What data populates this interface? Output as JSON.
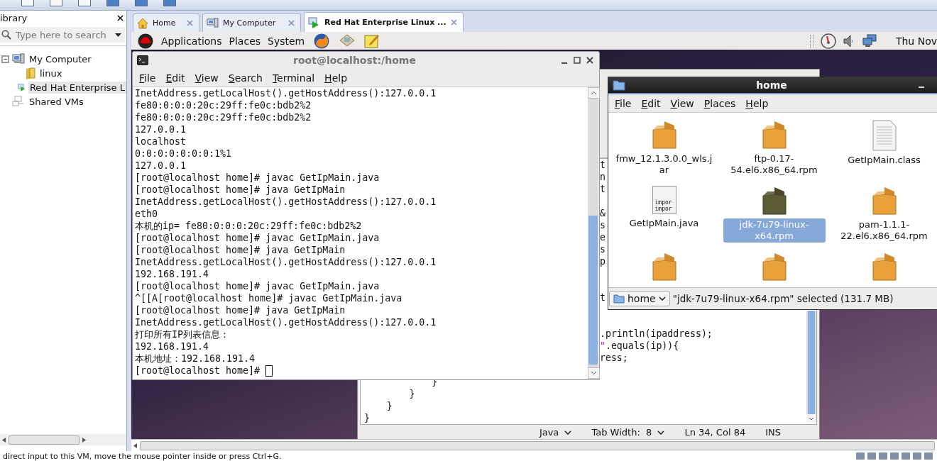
{
  "sidebar": {
    "title": "ibrary",
    "search": {
      "placeholder": "Type here to search"
    },
    "tree": [
      {
        "label": "My Computer",
        "kind": "computer",
        "expanded": true,
        "selected": false,
        "children": [
          {
            "label": "linux",
            "kind": "folder",
            "selected": false
          },
          {
            "label": "Red Hat Enterprise L",
            "kind": "vm",
            "selected": true
          }
        ]
      },
      {
        "label": "Shared VMs",
        "kind": "shared",
        "selected": false
      }
    ]
  },
  "tabs": [
    {
      "label": "Home",
      "kind": "home",
      "selected": false
    },
    {
      "label": "My Computer",
      "kind": "computer",
      "selected": false
    },
    {
      "label": "Red Hat Enterprise Linux ...",
      "kind": "vm",
      "selected": true
    }
  ],
  "guest_panel": {
    "menus": [
      "Applications",
      "Places",
      "System"
    ],
    "clock": "Thu Nov"
  },
  "terminal": {
    "title": "root@localhost:/home",
    "menus": [
      "File",
      "Edit",
      "View",
      "Search",
      "Terminal",
      "Help"
    ],
    "cursor": true,
    "lines": [
      "InetAddress.getLocalHost().getHostAddress():127.0.0.1",
      "fe80:0:0:0:20c:29ff:fe0c:bdb2%2",
      "fe80:0:0:0:20c:29ff:fe0c:bdb2%2",
      "127.0.0.1",
      "localhost",
      "0:0:0:0:0:0:0:1%1",
      "127.0.0.1",
      "[root@localhost home]# javac GetIpMain.java",
      "[root@localhost home]# java GetIpMain",
      "InetAddress.getLocalHost().getHostAddress():127.0.0.1",
      "eth0",
      "本机的ip= fe80:0:0:0:20c:29ff:fe0c:bdb2%2",
      "[root@localhost home]# javac GetIpMain.java",
      "[root@localhost home]# java GetIpMain",
      "InetAddress.getLocalHost().getHostAddress():127.0.0.1",
      "192.168.191.4",
      "[root@localhost home]# javac GetIpMain.java",
      "^[[A[root@localhost home]# javac GetIpMain.java",
      "[root@localhost home]# java GetIpMain",
      "InetAddress.getLocalHost().getHostAddress():127.0.0.1",
      "打印所有IP列表信息：",
      "192.168.191.4",
      "本机地址：192.168.191.4",
      "[root@localhost home]# "
    ]
  },
  "editor": {
    "text_blocks": [
      {
        "lines": [
          [
            {
              "kind": "code",
              "text": "t"
            }
          ],
          [
            {
              "kind": "code",
              "text": "n"
            }
          ],
          [
            {
              "kind": "code",
              "text": "t"
            }
          ]
        ]
      },
      {
        "lines": [
          [
            {
              "kind": "code",
              "text": "&"
            }
          ],
          [
            {
              "kind": "code",
              "text": "s"
            }
          ],
          [
            {
              "kind": "code",
              "text": "e"
            }
          ],
          [
            {
              "kind": "code",
              "text": "s"
            }
          ],
          [
            {
              "kind": "code",
              "text": "p"
            }
          ]
        ]
      },
      {
        "lines": [
          [
            {
              "kind": "code",
              "text": "t"
            }
          ]
        ]
      },
      {
        "lines": [
          [
            {
              "kind": "code",
              "text": ".println(ipaddress);"
            }
          ],
          [
            {
              "kind": "string",
              "text": "\""
            },
            {
              "kind": "code",
              "text": ".equals(ip)){"
            }
          ],
          [
            {
              "kind": "code",
              "text": "ress;"
            }
          ]
        ]
      },
      {
        "lines": [
          [
            {
              "kind": "code",
              "text": "            }"
            }
          ],
          [
            {
              "kind": "code",
              "text": "        }"
            }
          ],
          [
            {
              "kind": "code",
              "text": "    }"
            }
          ],
          [
            {
              "kind": "code",
              "text": "}"
            }
          ]
        ]
      }
    ],
    "status": [
      {
        "kind": "dropdown",
        "text": "Java"
      },
      {
        "kind": "dropdown",
        "text": "Tab Width:  8"
      },
      {
        "kind": "text",
        "text": "Ln 34, Col 84"
      },
      {
        "kind": "text",
        "text": "INS"
      }
    ]
  },
  "file_manager": {
    "title": "home",
    "menus": [
      "File",
      "Edit",
      "View",
      "Places",
      "Help"
    ],
    "files": [
      {
        "name": "fmw_12.1.3.0.0_wls.jar",
        "kind": "package",
        "selected": false
      },
      {
        "name": "ftp-0.17-54.el6.x86_64.rpm",
        "kind": "package",
        "selected": false
      },
      {
        "name": "GetIpMain.class",
        "kind": "document",
        "selected": false
      },
      {
        "name": "GetIpMain.java",
        "kind": "source",
        "preview": [
          "impor",
          "impor"
        ],
        "selected": false
      },
      {
        "name": "jdk-7u79-linux-x64.rpm",
        "kind": "package",
        "selected": true
      },
      {
        "name": "pam-1.1.1-22.el6.x86_64.rpm",
        "kind": "package",
        "selected": false
      },
      {
        "kind": "package",
        "selected": false
      },
      {
        "kind": "package",
        "selected": false
      },
      {
        "kind": "package",
        "selected": false
      }
    ],
    "location": "home",
    "status": "\"jdk-7u79-linux-x64.rpm\" selected (131.7 MB)"
  },
  "status_bar": {
    "message": "direct input to this VM, move the mouse pointer inside or press Ctrl+G."
  }
}
